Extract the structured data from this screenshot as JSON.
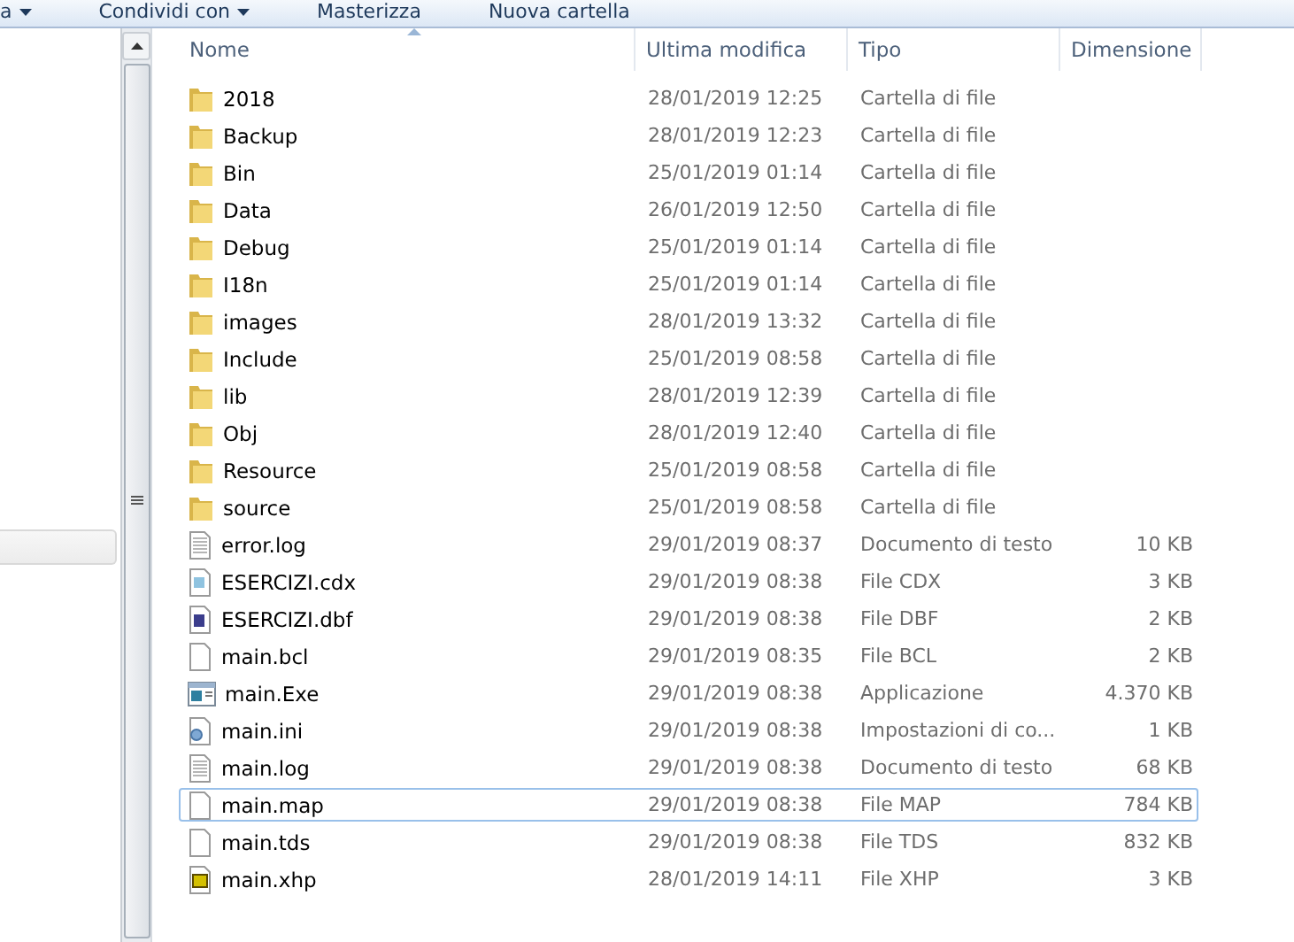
{
  "toolbar": {
    "items": [
      {
        "label": "a",
        "dropdown": true
      },
      {
        "label": "Condividi con",
        "dropdown": true
      },
      {
        "label": "Masterizza",
        "dropdown": false
      },
      {
        "label": "Nuova cartella",
        "dropdown": false
      }
    ]
  },
  "table": {
    "columns": [
      {
        "label": "Nome",
        "sorted": true
      },
      {
        "label": "Ultima modifica",
        "sorted": false
      },
      {
        "label": "Tipo",
        "sorted": false
      },
      {
        "label": "Dimensione",
        "sorted": false
      }
    ],
    "rows": [
      {
        "kind": "folder",
        "name": "2018",
        "modified": "28/01/2019 12:25",
        "type": "Cartella di file",
        "focused": false
      },
      {
        "kind": "folder",
        "name": "Backup",
        "modified": "28/01/2019 12:23",
        "type": "Cartella di file",
        "focused": false
      },
      {
        "kind": "folder",
        "name": "Bin",
        "modified": "25/01/2019 01:14",
        "type": "Cartella di file",
        "focused": false
      },
      {
        "kind": "folder",
        "name": "Data",
        "modified": "26/01/2019 12:50",
        "type": "Cartella di file",
        "focused": false
      },
      {
        "kind": "folder",
        "name": "Debug",
        "modified": "25/01/2019 01:14",
        "type": "Cartella di file",
        "focused": false
      },
      {
        "kind": "folder",
        "name": "I18n",
        "modified": "25/01/2019 01:14",
        "type": "Cartella di file",
        "focused": false
      },
      {
        "kind": "folder",
        "name": "images",
        "modified": "28/01/2019 13:32",
        "type": "Cartella di file",
        "focused": false
      },
      {
        "kind": "folder",
        "name": "Include",
        "modified": "25/01/2019 08:58",
        "type": "Cartella di file",
        "focused": false
      },
      {
        "kind": "folder",
        "name": "lib",
        "modified": "28/01/2019 12:39",
        "type": "Cartella di file",
        "focused": false
      },
      {
        "kind": "folder",
        "name": "Obj",
        "modified": "28/01/2019 12:40",
        "type": "Cartella di file",
        "focused": false
      },
      {
        "kind": "folder",
        "name": "Resource",
        "modified": "25/01/2019 08:58",
        "type": "Cartella di file",
        "focused": false
      },
      {
        "kind": "folder",
        "name": "source",
        "modified": "25/01/2019 08:58",
        "type": "Cartella di file",
        "focused": false
      },
      {
        "kind": "text",
        "name": "error.log",
        "modified": "29/01/2019 08:37",
        "type": "Documento di testo",
        "size": "10 KB",
        "focused": false
      },
      {
        "kind": "index",
        "name": "ESERCIZI.cdx",
        "modified": "29/01/2019 08:38",
        "type": "File CDX",
        "size": "3 KB",
        "focused": false
      },
      {
        "kind": "database",
        "name": "ESERCIZI.dbf",
        "modified": "29/01/2019 08:38",
        "type": "File DBF",
        "size": "2 KB",
        "focused": false
      },
      {
        "kind": "blank",
        "name": "main.bcl",
        "modified": "29/01/2019 08:35",
        "type": "File BCL",
        "size": "2 KB",
        "focused": false
      },
      {
        "kind": "app",
        "name": "main.Exe",
        "modified": "29/01/2019 08:38",
        "type": "Applicazione",
        "size": "4.370 KB",
        "focused": false
      },
      {
        "kind": "settings",
        "name": "main.ini",
        "modified": "29/01/2019 08:38",
        "type": "Impostazioni di co...",
        "size": "1 KB",
        "focused": false
      },
      {
        "kind": "text",
        "name": "main.log",
        "modified": "29/01/2019 08:38",
        "type": "Documento di testo",
        "size": "68 KB",
        "focused": false
      },
      {
        "kind": "blank",
        "name": "main.map",
        "modified": "29/01/2019 08:38",
        "type": "File MAP",
        "size": "784 KB",
        "focused": true
      },
      {
        "kind": "blank",
        "name": "main.tds",
        "modified": "29/01/2019 08:38",
        "type": "File TDS",
        "size": "832 KB",
        "focused": false
      },
      {
        "kind": "help",
        "name": "main.xhp",
        "modified": "28/01/2019 14:11",
        "type": "File XHP",
        "size": "3 KB",
        "focused": false
      }
    ]
  }
}
